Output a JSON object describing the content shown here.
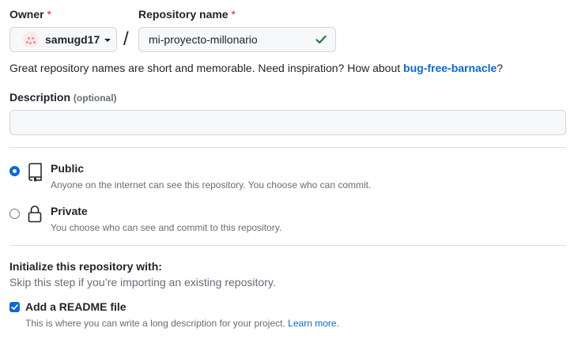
{
  "owner": {
    "label": "Owner",
    "required_mark": "*",
    "username": "samugd17"
  },
  "separator": "/",
  "repo_name": {
    "label": "Repository name",
    "required_mark": "*",
    "value": "mi-proyecto-millonario",
    "status_icon": "check-icon"
  },
  "hint": {
    "prefix": "Great repository names are short and memorable. Need inspiration? How about ",
    "suggestion": "bug-free-barnacle",
    "suffix": "?"
  },
  "description": {
    "label": "Description",
    "optional_label": "(optional)",
    "value": ""
  },
  "visibility": {
    "public": {
      "title": "Public",
      "description": "Anyone on the internet can see this repository. You choose who can commit.",
      "selected": true,
      "icon": "repo-icon"
    },
    "private": {
      "title": "Private",
      "description": "You choose who can see and commit to this repository.",
      "selected": false,
      "icon": "lock-icon"
    }
  },
  "initialize": {
    "title": "Initialize this repository with:",
    "subtitle": "Skip this step if you’re importing an existing repository.",
    "readme": {
      "label": "Add a README file",
      "description": "This is where you can write a long description for your project.",
      "link": "Learn more.",
      "checked": true
    }
  },
  "colors": {
    "accent": "#0969da",
    "success": "#1a7f37",
    "required": "#d1242f"
  }
}
